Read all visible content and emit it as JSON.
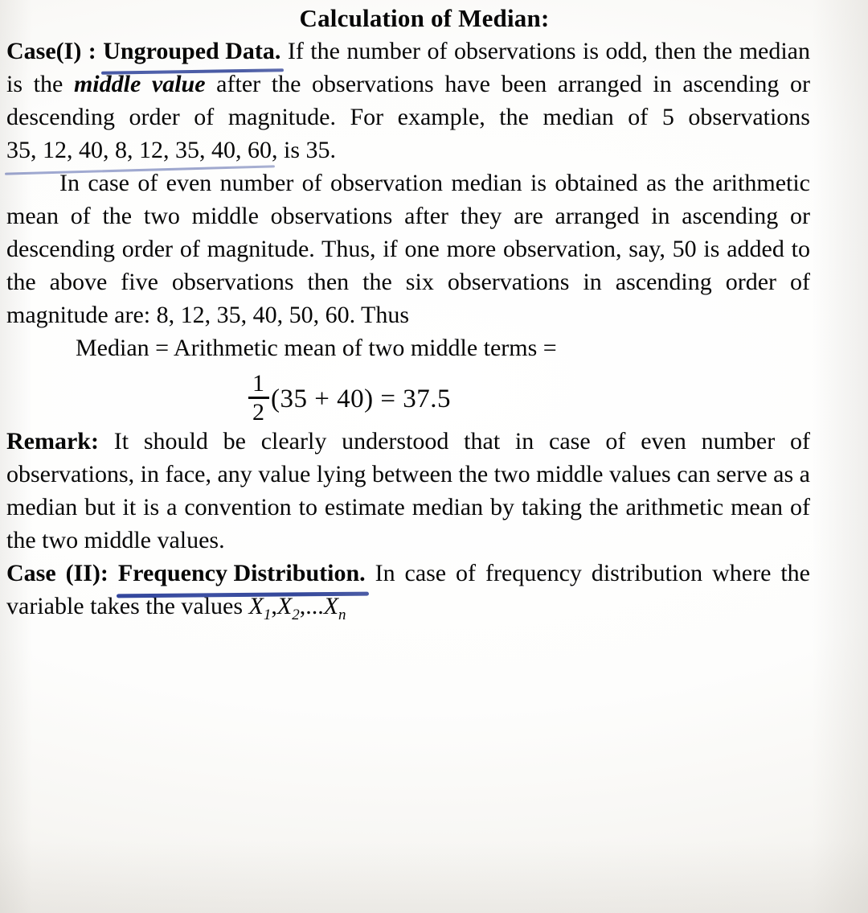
{
  "document": {
    "title": "Calculation of Median:",
    "sections": [
      {
        "id": "case-1",
        "lead": "Case(I) : ",
        "lead_underlined": "Ungrouped Data.",
        "body_1": " If the number of observations is odd, then the median is the ",
        "emphasis": "middle value",
        "body_2": " after the observations have been arranged in ascending or descending order of magnitude. For example, the median of 5 observations ",
        "data_list_1": "35, 12, 40, 8, 12, 35, 40, 60",
        "body_3": ", is 35."
      },
      {
        "id": "even-case",
        "body": "In case of even number of observation median is obtained as the arithmetic mean of the two middle observations after they are arranged in ascending or descending order of magnitude. Thus, if one more observation, say, 50 is added to the above five observations then the six observations in ascending order of magnitude are: 8, 12, 35, 40, 50, 60. Thus"
      },
      {
        "id": "median-equation",
        "text": "Median = Arithmetic mean of two middle terms ="
      },
      {
        "id": "fraction",
        "numerator": "1",
        "denominator": "2",
        "expression": "(35 + 40) = 37.5"
      },
      {
        "id": "remark",
        "lead": "Remark:",
        "body": " It should be clearly understood that in case of even number of observations, in face, any value lying between the two middle values can serve as a median but it is a convention to estimate median by taking the arithmetic mean of the two middle values."
      },
      {
        "id": "case-2",
        "lead": "Case (II): ",
        "lead_underlined": "Frequency Distribution.",
        "body": " In case of frequency distribution where the variable takes the values ",
        "variables_1": "X",
        "variables_sub_1": "1",
        "variables_sep_1": ",",
        "variables_2": "X",
        "variables_sub_2": "2",
        "variables_sep_2": ",...",
        "variables_3": "X",
        "variables_sub_3": "n"
      }
    ]
  },
  "colors": {
    "ink": "#0c0c0c",
    "pen_underline": "#2b3f96",
    "paper": "#fdfdfc"
  }
}
